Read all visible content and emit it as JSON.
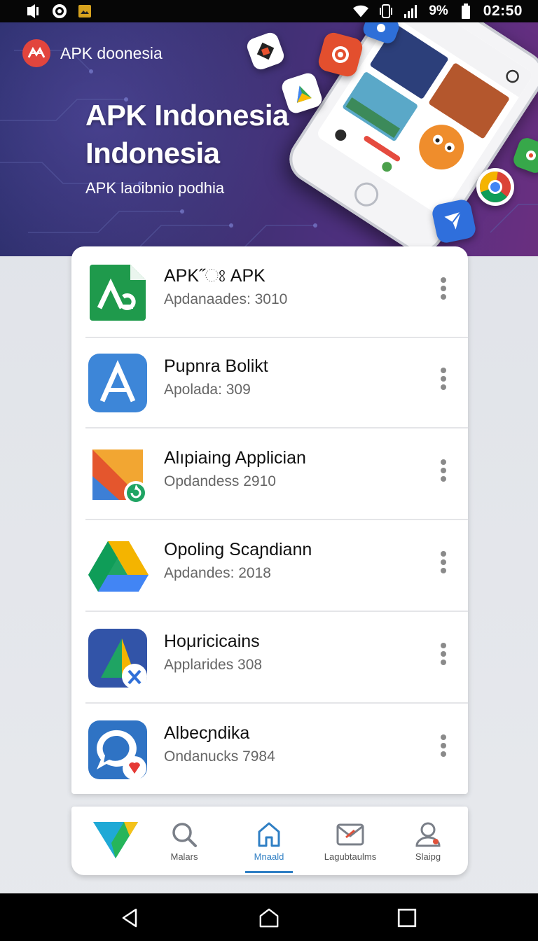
{
  "status_bar": {
    "battery_text": "9%",
    "time": "02:50",
    "icons_left": [
      "media-icon",
      "sync-icon",
      "image-icon"
    ],
    "icons_right": [
      "wifi-icon",
      "vibrate-icon",
      "signal-icon",
      "battery-icon"
    ]
  },
  "brand": {
    "name": "APK doonesia",
    "logo_color": "#e2453d"
  },
  "hero": {
    "title": "APK Indonesia Indonesia",
    "subtitle": "APK laoibnio podhia",
    "gradient_start": "#272c67",
    "gradient_end": "#6a2f7f",
    "floating_icons": [
      "store-icon",
      "record-icon",
      "play-store-icon",
      "cloud-icon",
      "leaf-icon",
      "chrome-icon",
      "send-icon"
    ]
  },
  "apps": [
    {
      "name": "APK˝ଃ APK",
      "meta": "Apdanaades: 3010",
      "icon": "apk-green-icon",
      "color": "#1f9a4c"
    },
    {
      "name": "Pupnra Bolikt",
      "meta": "Apolada: 309",
      "icon": "app-store-a-icon",
      "color": "#3d86d8"
    },
    {
      "name": "Alıpiaing Applician",
      "meta": "Opdandess 2910",
      "icon": "fold-arrow-icon",
      "color": "#e4562d"
    },
    {
      "name": "Opoling Scaɲdiann",
      "meta": "Apdandes: 2018",
      "icon": "drive-icon",
      "color": "#1fa463"
    },
    {
      "name": "Hoμricicains",
      "meta": "Applarides 308",
      "icon": "triangle-x-icon",
      "color": "#3254a8"
    },
    {
      "name": "Albecɲdika",
      "meta": "Ondanucks 7984",
      "icon": "chat-bubble-icon",
      "color": "#2f73c4"
    }
  ],
  "bottom_nav": {
    "items": [
      {
        "label": "",
        "icon": "brand-v-icon"
      },
      {
        "label": "Malars",
        "icon": "search-icon"
      },
      {
        "label": "Mnaald",
        "icon": "home-icon",
        "active": true
      },
      {
        "label": "Lagubtaulms",
        "icon": "mail-icon"
      },
      {
        "label": "Slaipg",
        "icon": "profile-icon"
      }
    ],
    "active_color": "#2f7fc4"
  },
  "system_nav": [
    "back-icon",
    "home-icon",
    "recents-icon"
  ]
}
